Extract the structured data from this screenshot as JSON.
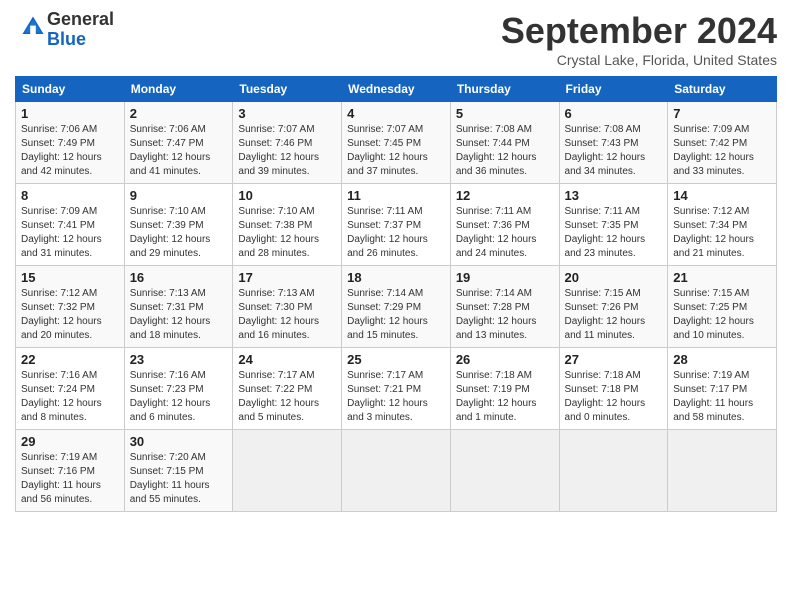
{
  "header": {
    "logo_general": "General",
    "logo_blue": "Blue",
    "month_title": "September 2024",
    "location": "Crystal Lake, Florida, United States"
  },
  "days_of_week": [
    "Sunday",
    "Monday",
    "Tuesday",
    "Wednesday",
    "Thursday",
    "Friday",
    "Saturday"
  ],
  "weeks": [
    [
      {
        "num": "1",
        "sunrise": "7:06 AM",
        "sunset": "7:49 PM",
        "daylight": "12 hours and 42 minutes."
      },
      {
        "num": "2",
        "sunrise": "7:06 AM",
        "sunset": "7:47 PM",
        "daylight": "12 hours and 41 minutes."
      },
      {
        "num": "3",
        "sunrise": "7:07 AM",
        "sunset": "7:46 PM",
        "daylight": "12 hours and 39 minutes."
      },
      {
        "num": "4",
        "sunrise": "7:07 AM",
        "sunset": "7:45 PM",
        "daylight": "12 hours and 37 minutes."
      },
      {
        "num": "5",
        "sunrise": "7:08 AM",
        "sunset": "7:44 PM",
        "daylight": "12 hours and 36 minutes."
      },
      {
        "num": "6",
        "sunrise": "7:08 AM",
        "sunset": "7:43 PM",
        "daylight": "12 hours and 34 minutes."
      },
      {
        "num": "7",
        "sunrise": "7:09 AM",
        "sunset": "7:42 PM",
        "daylight": "12 hours and 33 minutes."
      }
    ],
    [
      {
        "num": "8",
        "sunrise": "7:09 AM",
        "sunset": "7:41 PM",
        "daylight": "12 hours and 31 minutes."
      },
      {
        "num": "9",
        "sunrise": "7:10 AM",
        "sunset": "7:39 PM",
        "daylight": "12 hours and 29 minutes."
      },
      {
        "num": "10",
        "sunrise": "7:10 AM",
        "sunset": "7:38 PM",
        "daylight": "12 hours and 28 minutes."
      },
      {
        "num": "11",
        "sunrise": "7:11 AM",
        "sunset": "7:37 PM",
        "daylight": "12 hours and 26 minutes."
      },
      {
        "num": "12",
        "sunrise": "7:11 AM",
        "sunset": "7:36 PM",
        "daylight": "12 hours and 24 minutes."
      },
      {
        "num": "13",
        "sunrise": "7:11 AM",
        "sunset": "7:35 PM",
        "daylight": "12 hours and 23 minutes."
      },
      {
        "num": "14",
        "sunrise": "7:12 AM",
        "sunset": "7:34 PM",
        "daylight": "12 hours and 21 minutes."
      }
    ],
    [
      {
        "num": "15",
        "sunrise": "7:12 AM",
        "sunset": "7:32 PM",
        "daylight": "12 hours and 20 minutes."
      },
      {
        "num": "16",
        "sunrise": "7:13 AM",
        "sunset": "7:31 PM",
        "daylight": "12 hours and 18 minutes."
      },
      {
        "num": "17",
        "sunrise": "7:13 AM",
        "sunset": "7:30 PM",
        "daylight": "12 hours and 16 minutes."
      },
      {
        "num": "18",
        "sunrise": "7:14 AM",
        "sunset": "7:29 PM",
        "daylight": "12 hours and 15 minutes."
      },
      {
        "num": "19",
        "sunrise": "7:14 AM",
        "sunset": "7:28 PM",
        "daylight": "12 hours and 13 minutes."
      },
      {
        "num": "20",
        "sunrise": "7:15 AM",
        "sunset": "7:26 PM",
        "daylight": "12 hours and 11 minutes."
      },
      {
        "num": "21",
        "sunrise": "7:15 AM",
        "sunset": "7:25 PM",
        "daylight": "12 hours and 10 minutes."
      }
    ],
    [
      {
        "num": "22",
        "sunrise": "7:16 AM",
        "sunset": "7:24 PM",
        "daylight": "12 hours and 8 minutes."
      },
      {
        "num": "23",
        "sunrise": "7:16 AM",
        "sunset": "7:23 PM",
        "daylight": "12 hours and 6 minutes."
      },
      {
        "num": "24",
        "sunrise": "7:17 AM",
        "sunset": "7:22 PM",
        "daylight": "12 hours and 5 minutes."
      },
      {
        "num": "25",
        "sunrise": "7:17 AM",
        "sunset": "7:21 PM",
        "daylight": "12 hours and 3 minutes."
      },
      {
        "num": "26",
        "sunrise": "7:18 AM",
        "sunset": "7:19 PM",
        "daylight": "12 hours and 1 minute."
      },
      {
        "num": "27",
        "sunrise": "7:18 AM",
        "sunset": "7:18 PM",
        "daylight": "12 hours and 0 minutes."
      },
      {
        "num": "28",
        "sunrise": "7:19 AM",
        "sunset": "7:17 PM",
        "daylight": "11 hours and 58 minutes."
      }
    ],
    [
      {
        "num": "29",
        "sunrise": "7:19 AM",
        "sunset": "7:16 PM",
        "daylight": "11 hours and 56 minutes."
      },
      {
        "num": "30",
        "sunrise": "7:20 AM",
        "sunset": "7:15 PM",
        "daylight": "11 hours and 55 minutes."
      },
      null,
      null,
      null,
      null,
      null
    ]
  ]
}
